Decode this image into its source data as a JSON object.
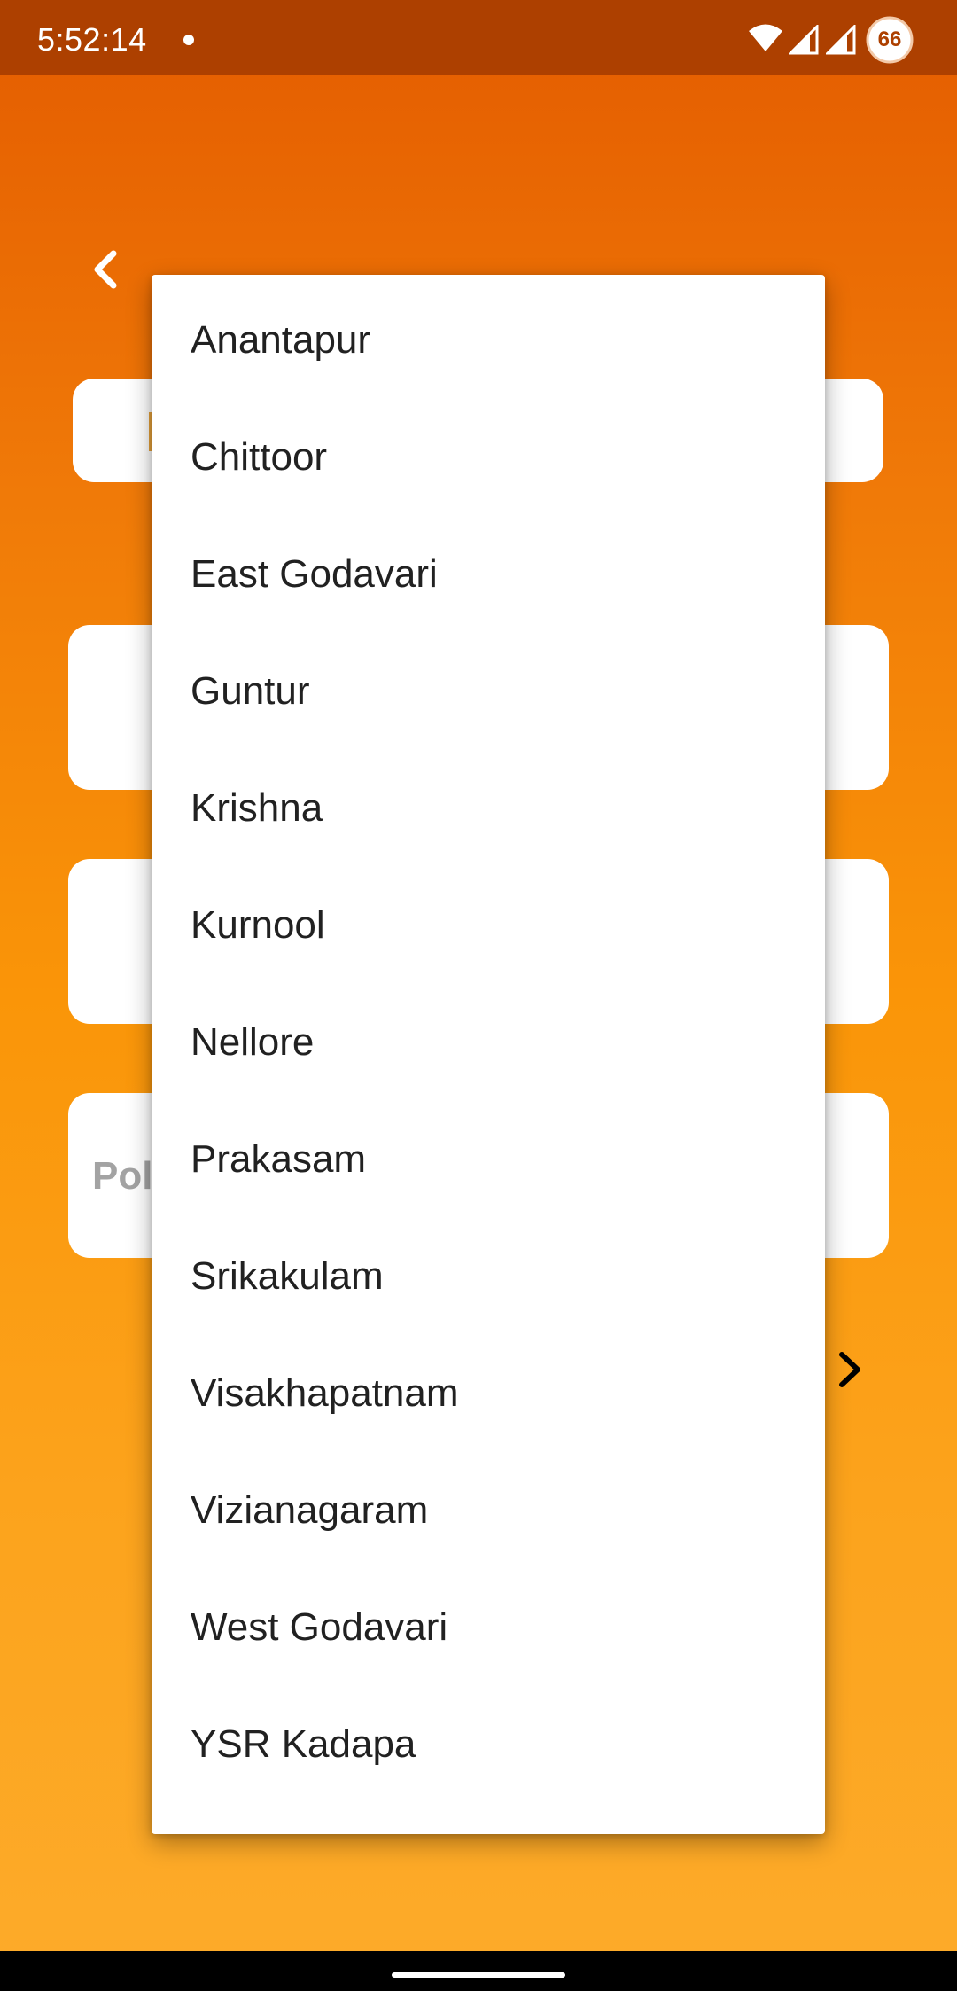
{
  "status_bar": {
    "time": "5:52:14",
    "battery": "66"
  },
  "background_form": {
    "card_3_label": "Pol"
  },
  "dropdown": {
    "items": [
      "Anantapur",
      "Chittoor",
      "East Godavari",
      "Guntur",
      "Krishna",
      "Kurnool",
      "Nellore",
      "Prakasam",
      "Srikakulam",
      "Visakhapatnam",
      "Vizianagaram",
      "West Godavari",
      "YSR Kadapa"
    ]
  },
  "colors": {
    "gradient_top": "#e45c00",
    "gradient_bottom": "#fdab2a",
    "status_bar": "#ad4000",
    "menu_background": "#ffffff",
    "menu_text": "#212121"
  },
  "icons": {
    "back": "chevron-left-icon",
    "next": "chevron-right-icon",
    "wifi": "wifi-icon",
    "signal": "signal-icon",
    "battery": "battery-icon"
  }
}
